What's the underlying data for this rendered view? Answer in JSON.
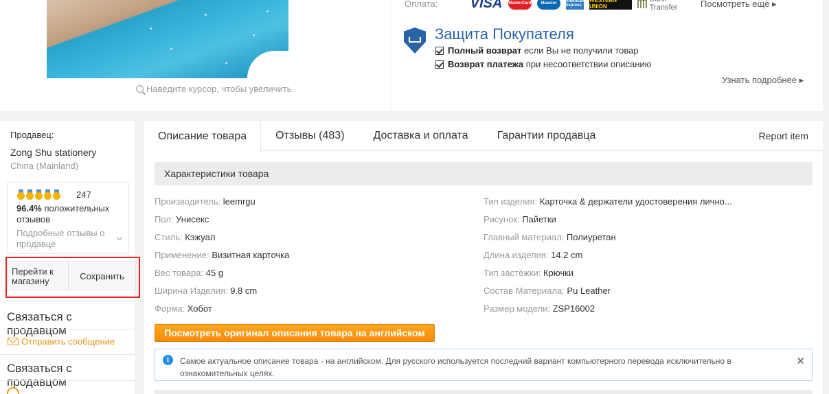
{
  "gallery": {
    "zoom_hint": "Наведите курсор, чтобы увеличить"
  },
  "payment": {
    "label": "Оплата:",
    "logos": [
      "VISA",
      "MasterCard",
      "Maestro",
      "American Express",
      "WESTERN UNION",
      "Bank Transfer"
    ],
    "bank_transfer_label": "Bank Transfer",
    "see_more": "Посмотреть ещё ▸"
  },
  "protection": {
    "title": "Защита Покупателя",
    "line1_bold": "Полный возврат",
    "line1_rest": " если Вы не получили товар",
    "line2_bold": "Возврат платежа",
    "line2_rest": " при несоответствии описанию",
    "learn_more": "Узнать подробнее ▸"
  },
  "seller": {
    "label": "Продавец:",
    "name": "Zong Shu stationery",
    "country": "China (Mainland)",
    "rating_count": "247",
    "positive_percent": "96.4%",
    "positive_text": "положительных отзывов",
    "detail_link": "Подробные отзывы о продавце",
    "go_to_store": "Перейти к магазину",
    "save": "Сохранить",
    "contact_heading_1": "Связаться с продавцом",
    "send_message": "Отправить сообщение",
    "contact_heading_2": "Связаться с продавцом"
  },
  "tabs": [
    {
      "label": "Описание товара",
      "active": true
    },
    {
      "label": "Отзывы (483)",
      "active": false
    },
    {
      "label": "Доставка и оплата",
      "active": false
    },
    {
      "label": "Гарантии продавца",
      "active": false
    }
  ],
  "report_item": "Report item",
  "specs": {
    "heading": "Характеристики товара",
    "left": [
      {
        "k": "Производитель:",
        "v": "leemrgu"
      },
      {
        "k": "Пол:",
        "v": "Унисекс"
      },
      {
        "k": "Стиль:",
        "v": "Кэжуал"
      },
      {
        "k": "Применение:",
        "v": "Визитная карточка"
      },
      {
        "k": "Вес товара:",
        "v": "45 g"
      },
      {
        "k": "Ширина Изделия:",
        "v": "9.8 cm"
      },
      {
        "k": "Форма:",
        "v": "Хобот"
      }
    ],
    "right": [
      {
        "k": "Тип изделия:",
        "v": "Карточка & держатели удостоверения лично..."
      },
      {
        "k": "Рисунок:",
        "v": "Пайетки"
      },
      {
        "k": "Главный материал:",
        "v": "Полиуретан"
      },
      {
        "k": "Длина изделия:",
        "v": "14.2 cm"
      },
      {
        "k": "Тип застёжки:",
        "v": "Крючки"
      },
      {
        "k": "Состав Материала:",
        "v": "Pu Leather"
      },
      {
        "k": "Размер модели:",
        "v": "ZSP16002"
      }
    ]
  },
  "original_button": "Посмотреть оригинал описания товара на английском",
  "info": {
    "icon": "i",
    "text": "Самое актуальное описание товара - на английском. Для русского используется последний вариант компьютерного перевода исключительно в ознакомительных целях.",
    "close": "✕"
  },
  "colors": {
    "accent": "#f78b02",
    "protection_blue": "#2a64a8",
    "highlight_red": "#e22222",
    "info_blue": "#1f8fe6"
  }
}
